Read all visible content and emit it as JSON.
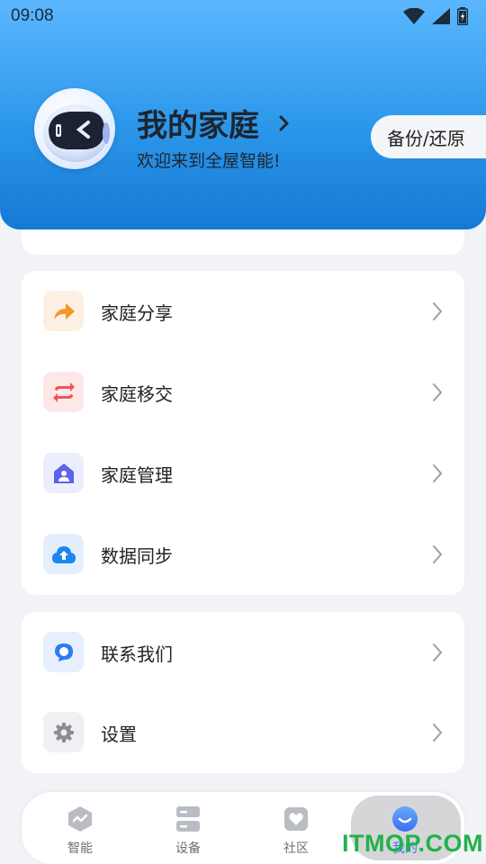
{
  "status": {
    "time": "09:08"
  },
  "header": {
    "title": "我的家庭",
    "welcome": "欢迎来到全屋智能!",
    "backup_label": "备份/还原"
  },
  "menu": {
    "items": [
      {
        "label": "家庭分享",
        "icon": "share-arrow-icon",
        "color": "#f5962a"
      },
      {
        "label": "家庭移交",
        "icon": "transfer-arrows-icon",
        "color": "#f0535a"
      },
      {
        "label": "家庭管理",
        "icon": "home-person-icon",
        "color": "#5b63e8"
      },
      {
        "label": "数据同步",
        "icon": "cloud-upload-icon",
        "color": "#1e86f0"
      }
    ]
  },
  "contact": {
    "items": [
      {
        "label": "联系我们",
        "icon": "chat-bubble-icon",
        "color": "#2f7bf0"
      },
      {
        "label": "设置",
        "icon": "gear-icon",
        "color": "#8a8d92"
      }
    ]
  },
  "nav": {
    "items": [
      {
        "label": "智能",
        "icon": "smart-hexagon-icon"
      },
      {
        "label": "设备",
        "icon": "device-icon"
      },
      {
        "label": "社区",
        "icon": "community-heart-icon"
      },
      {
        "label": "我的",
        "icon": "profile-smile-icon",
        "active": true
      }
    ]
  },
  "watermark": "ITMOP.COM"
}
